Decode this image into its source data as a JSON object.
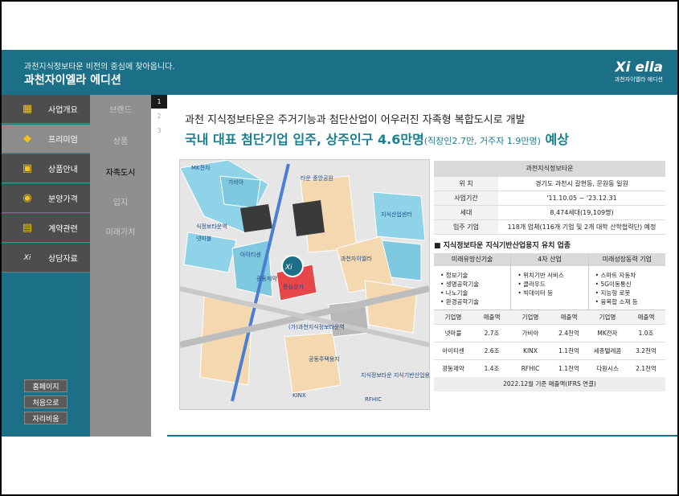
{
  "header": {
    "subtitle": "과천지식정보타운 비전의 중심에 찾아옵니다.",
    "title": "과천자이엘라 에디션",
    "logo_mark": "Xi ella",
    "logo_caption": "과천자이엘라 에디션"
  },
  "sidebar": {
    "items": [
      {
        "label": "사업개요",
        "icon": "building-icon"
      },
      {
        "label": "프리미엄",
        "icon": "diamond-icon"
      },
      {
        "label": "상품안내",
        "icon": "apartment-icon"
      },
      {
        "label": "분양가격",
        "icon": "money-icon"
      },
      {
        "label": "계약관련",
        "icon": "contract-icon"
      },
      {
        "label": "상담자료",
        "icon": "xi-logo-icon"
      }
    ],
    "buttons": [
      "홈페이지",
      "처음으로",
      "자리비움"
    ]
  },
  "submenu": [
    "브랜드",
    "상품",
    "자족도시",
    "입지",
    "미래가치"
  ],
  "pager": [
    "1",
    "2",
    "3"
  ],
  "content": {
    "intro": "과천 지식정보타운은 주거기능과 첨단산업이 어우러진 자족형 복합도시로 개발",
    "headline": "국내 대표 첨단기업 입주, 상주인구 4.6만명",
    "headline_small": "(직장인2.7만, 거주자 1.9만명)",
    "headline_end": " 예상",
    "map_labels": [
      "MK전자",
      "가비아",
      "넷마블",
      "KINX",
      "RFHIC",
      "아이티센",
      "광동제약",
      "중심상가",
      "지식산업센터",
      "(가)과천지식정보타운역",
      "과천자이엘라",
      "식정보타운역",
      "타운 중앙공원",
      "지식정보타운 지식기반산업용지",
      "공동주택용지"
    ],
    "info_title": "과천지식정보타운",
    "info_rows": [
      {
        "k": "위 치",
        "v": "경기도 과천시 갈현동, 문원동 일원"
      },
      {
        "k": "사업기간",
        "v": "'11.10.05 ~ '23.12.31"
      },
      {
        "k": "세대",
        "v": "8,474세대(19,109명)"
      },
      {
        "k": "입주 기업",
        "v": "118개 업체(116개 기업 및 2개 대학 산학협력단) 예정"
      }
    ],
    "section_title": "■ 지식정보타운 지식기반산업용지 유치 업종",
    "columns": [
      {
        "head": "미래유망신기술",
        "items": [
          "• 정보기술",
          "• 생명공학기술",
          "• 나노기술",
          "• 환경공학기술"
        ]
      },
      {
        "head": "4차 산업",
        "items": [
          "• 위치기반 서비스",
          "• 클라우드",
          "• 빅데이터 등"
        ]
      },
      {
        "head": "미래성장동력 기업",
        "items": [
          "• 스마트 자동차",
          "• 5G이동통신",
          "• 지능형 로봇",
          "• 융복합 소재 등"
        ]
      }
    ],
    "company_head": [
      "기업명",
      "매출액",
      "기업명",
      "매출액",
      "기업명",
      "매출액"
    ],
    "companies": [
      [
        "넷마블",
        "2.7조",
        "가비아",
        "2.4천억",
        "MK전자",
        "1.0조"
      ],
      [
        "아이티센",
        "2.6조",
        "KINX",
        "1.1천억",
        "세종텔레콤",
        "3.2천억"
      ],
      [
        "광동제약",
        "1.4조",
        "RFHIC",
        "1.1천억",
        "다원시스",
        "2.1천억"
      ]
    ],
    "footnote": "2022.12월 기준 매출액(IFRS 연결)"
  },
  "colors": {
    "teal": "#1b6f86",
    "headline": "#1a7f91",
    "sidebar_item": "#4d4d4d"
  }
}
